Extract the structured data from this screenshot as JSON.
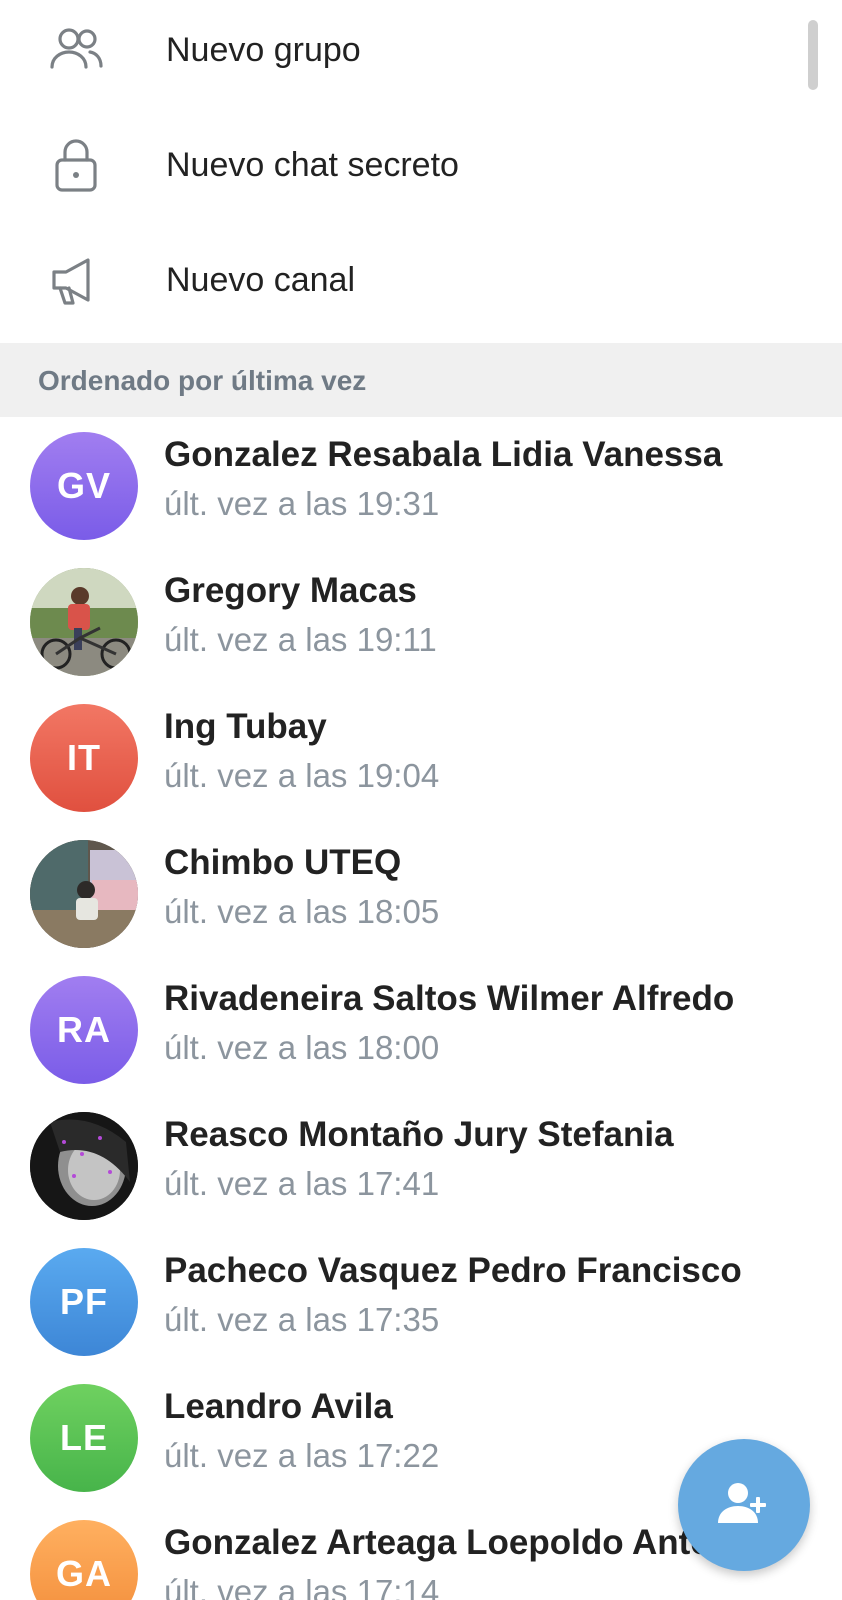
{
  "menu": {
    "items": [
      {
        "label": "Nuevo grupo",
        "icon": "group-icon"
      },
      {
        "label": "Nuevo chat secreto",
        "icon": "lock-icon"
      },
      {
        "label": "Nuevo canal",
        "icon": "megaphone-icon"
      }
    ]
  },
  "section": {
    "header": "Ordenado por última vez"
  },
  "contacts": [
    {
      "name": "Gonzalez Resabala Lidia Vanessa",
      "status": "últ. vez a las 19:31",
      "initials": "GV",
      "avatar": "initials",
      "color_top": "#a17ef0",
      "color_bottom": "#7a5ce8"
    },
    {
      "name": "Gregory Macas",
      "status": "últ. vez a las 19:11",
      "initials": "",
      "avatar": "photo-bike"
    },
    {
      "name": "Ing Tubay",
      "status": "últ. vez a las 19:04",
      "initials": "IT",
      "avatar": "initials",
      "color_top": "#f27764",
      "color_bottom": "#e0503f"
    },
    {
      "name": "Chimbo UTEQ",
      "status": "últ. vez a las 18:05",
      "initials": "",
      "avatar": "photo-room"
    },
    {
      "name": "Rivadeneira Saltos Wilmer Alfredo",
      "status": "últ. vez a las 18:00",
      "initials": "RA",
      "avatar": "initials",
      "color_top": "#a17ef0",
      "color_bottom": "#7a5ce8"
    },
    {
      "name": "Reasco Montaño Jury Stefania",
      "status": "últ. vez a las 17:41",
      "initials": "",
      "avatar": "photo-dark"
    },
    {
      "name": "Pacheco Vasquez Pedro Francisco",
      "status": "últ. vez a las 17:35",
      "initials": "PF",
      "avatar": "initials",
      "color_top": "#5aaaf0",
      "color_bottom": "#3d86d6"
    },
    {
      "name": "Leandro Avila",
      "status": "últ. vez a las 17:22",
      "initials": "LE",
      "avatar": "initials",
      "color_top": "#6fd160",
      "color_bottom": "#47b44a"
    },
    {
      "name": "Gonzalez Arteaga Loepoldo Anto",
      "status": "últ. vez a las 17:14",
      "initials": "GA",
      "avatar": "initials",
      "color_top": "#ffb060",
      "color_bottom": "#f38d3a"
    }
  ],
  "fab": {
    "icon": "add-contact-icon",
    "color": "#65a9e0"
  }
}
